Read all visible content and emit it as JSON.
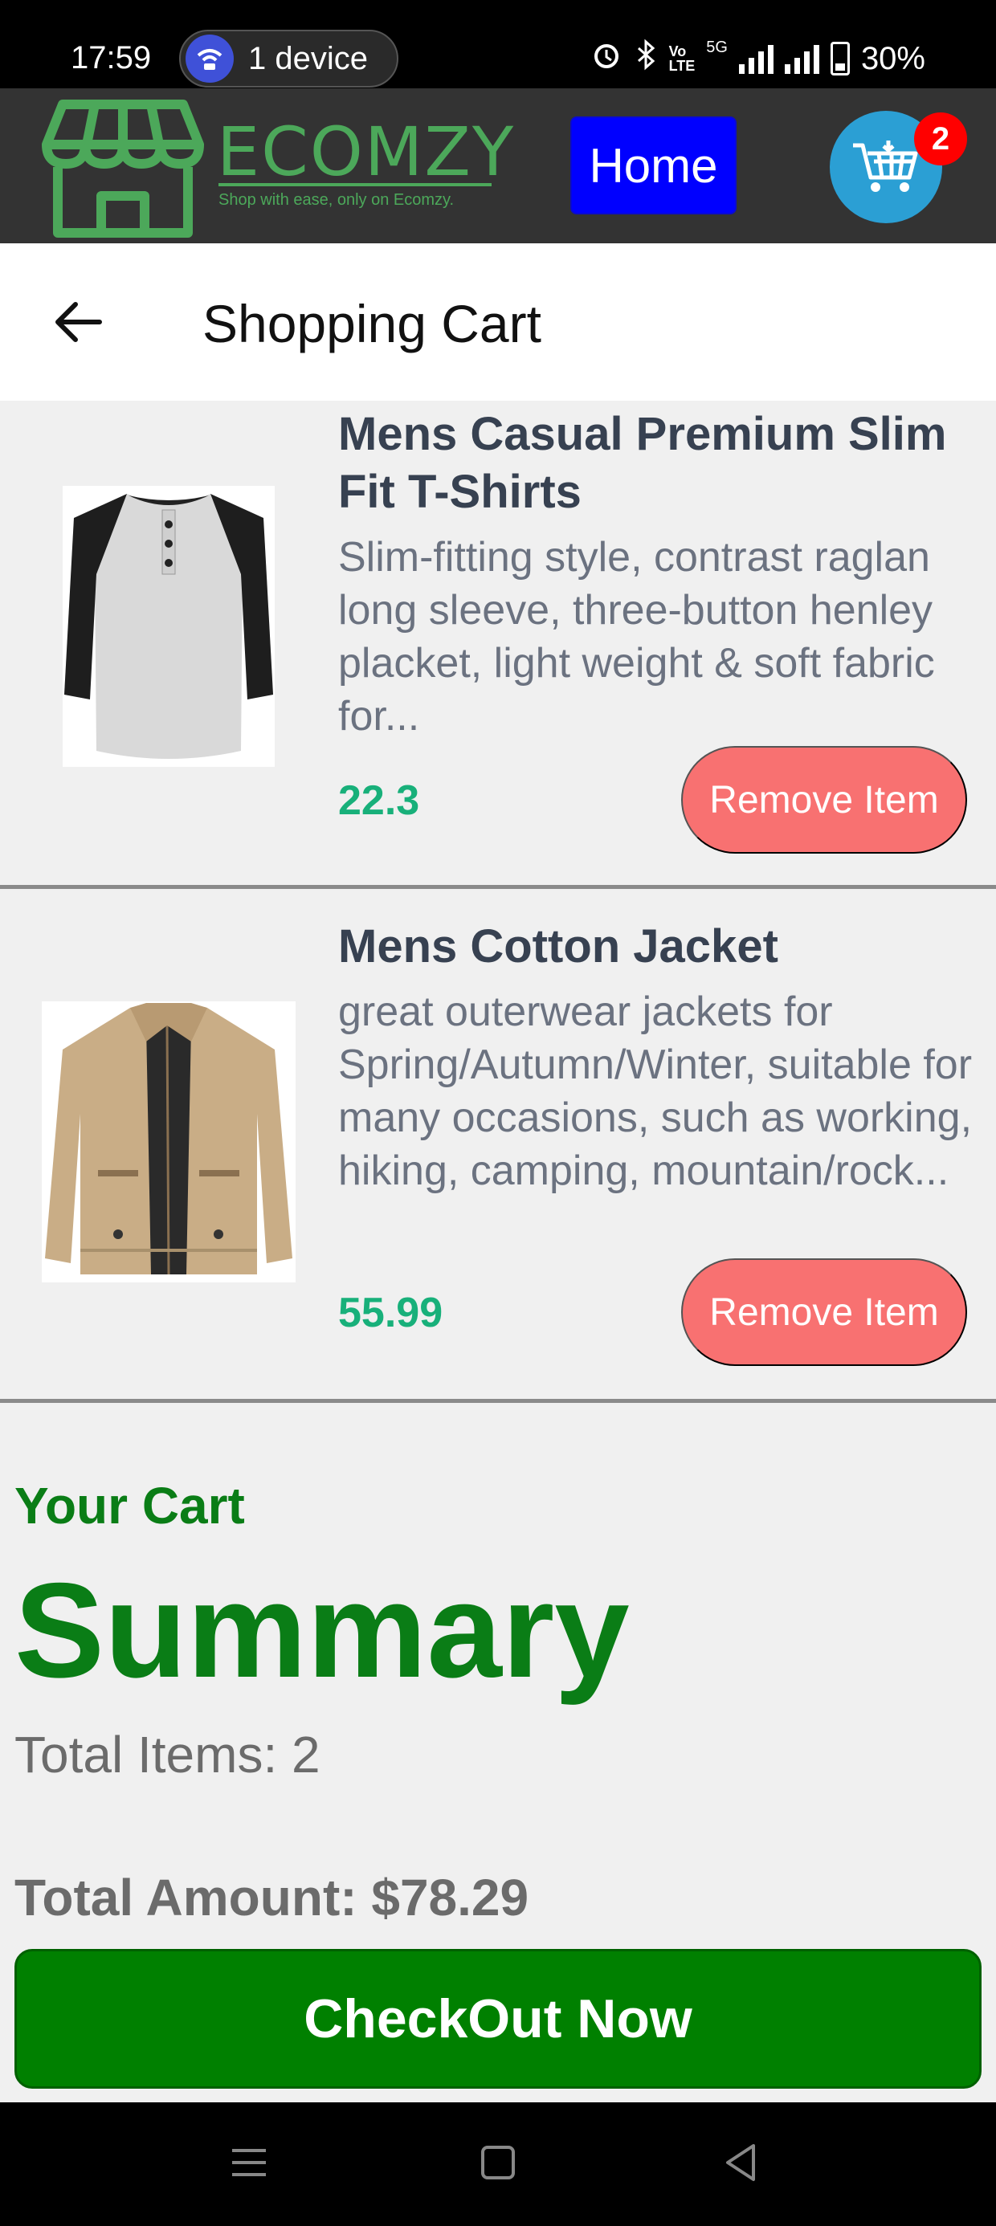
{
  "status_bar": {
    "time": "17:59",
    "device_label": "1 device",
    "battery": "30%",
    "network": "5G"
  },
  "header": {
    "logo_text": "ECOMZY",
    "tagline": "Shop with ease, only on Ecomzy.",
    "home_label": "Home",
    "cart_count": "2",
    "accent": "#4ca85a"
  },
  "page": {
    "title": "Shopping Cart"
  },
  "cart_items": [
    {
      "title": "Mens Casual Premium Slim Fit T-Shirts",
      "description": "Slim-fitting style, contrast raglan long sleeve, three-button henley placket, light weight & soft fabric for...",
      "price": "22.3",
      "remove_label": "Remove Item"
    },
    {
      "title": "Mens Cotton Jacket",
      "description": "great outerwear jackets for Spring/Autumn/Winter, suitable for many occasions, such as working, hiking, camping, mountain/rock...",
      "price": "55.99",
      "remove_label": "Remove Item"
    }
  ],
  "summary": {
    "kicker": "Your Cart",
    "title": "Summary",
    "total_items": "Total Items: 2",
    "total_amount": "Total Amount: $78.29",
    "checkout_label": "CheckOut Now"
  },
  "colors": {
    "header_bg": "#333333",
    "home_btn": "#0000ff",
    "cart_btn": "#2b9fd4",
    "price": "#18b07a",
    "remove_btn": "#f87171",
    "summary_green": "#0a7d16",
    "checkout_btn": "#008000"
  }
}
